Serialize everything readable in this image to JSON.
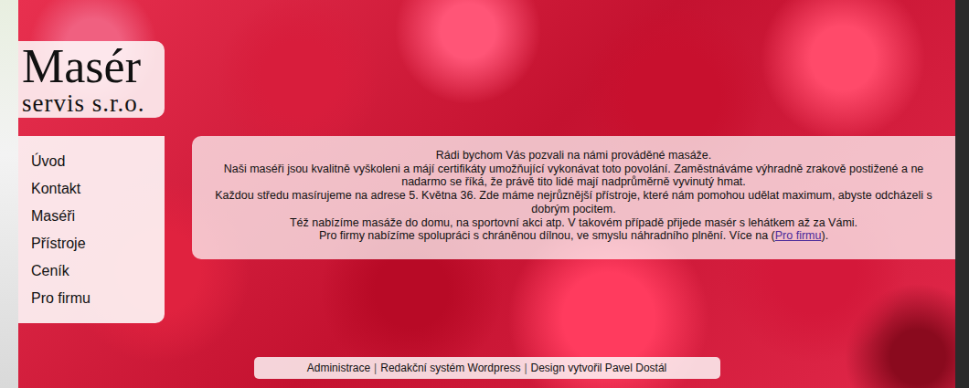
{
  "logo": {
    "title": "Masér",
    "subtitle": "servis s.r.o."
  },
  "sidebar": {
    "items": [
      {
        "label": "Úvod"
      },
      {
        "label": "Kontakt"
      },
      {
        "label": "Maséři"
      },
      {
        "label": "Přístroje"
      },
      {
        "label": "Ceník"
      },
      {
        "label": "Pro firmu"
      }
    ]
  },
  "content": {
    "paragraphs": [
      "Rádi bychom Vás pozvali na námi prováděné masáže.",
      "Naši maséři jsou kvalitně vyškoleni a májí certifikáty umožňující vykonávat toto povolání. Zaměstnáváme výhradně zrakově postižené a ne nadarmo se říká, že právě tito lidé mají nadprůměrně vyvinutý hmat.",
      "Každou středu masírujeme na adrese 5. Května 36. Zde máme nejrůznější přístroje, které nám pomohou udělat maximum, abyste odcházeli s dobrým pocitem.",
      "Též nabízíme masáže do domu, na sportovní akci atp. V takovém případě přijede masér s lehátkem až za Vámi."
    ],
    "last": {
      "before": "Pro firmy nabízíme spolupráci s chráněnou dílnou, ve smyslu náhradního plnění. Více na (",
      "link": "Pro firmu",
      "after": ")."
    }
  },
  "footer": {
    "separator": "|",
    "links": [
      "Administrace",
      "Redakční systém Wordpress",
      "Design vytvořil Pavel Dostál"
    ]
  }
}
